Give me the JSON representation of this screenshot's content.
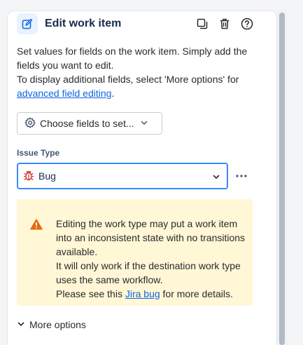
{
  "panel": {
    "title": "Edit work item",
    "header_icons": [
      "edit-icon",
      "copy-icon",
      "trash-icon",
      "help-icon"
    ]
  },
  "description": {
    "line1": "Set values for fields on the work item. Simply add the fields you want to edit.",
    "line2_prefix": "To display additional fields, select 'More options' for ",
    "line2_link": "advanced field editing",
    "line2_suffix": "."
  },
  "choose_fields": {
    "label": "Choose fields to set...",
    "icon": "gear-icon"
  },
  "issue_type": {
    "label": "Issue Type",
    "value": "Bug",
    "icon": "bug-icon"
  },
  "warning": {
    "line1": "Editing the work type may put a work item into an inconsistent state with no transitions available.",
    "line2": "It will only work if the destination work type uses the same workflow.",
    "line3_prefix": "Please see this ",
    "line3_link": "Jira bug",
    "line3_suffix": " for more details."
  },
  "more_options": {
    "label": "More options"
  },
  "colors": {
    "accent": "#0c66e4",
    "focus_border": "#388bff",
    "warning_bg": "#fff7d6",
    "warning_icon": "#e56910",
    "bug_icon": "#c9372c"
  }
}
